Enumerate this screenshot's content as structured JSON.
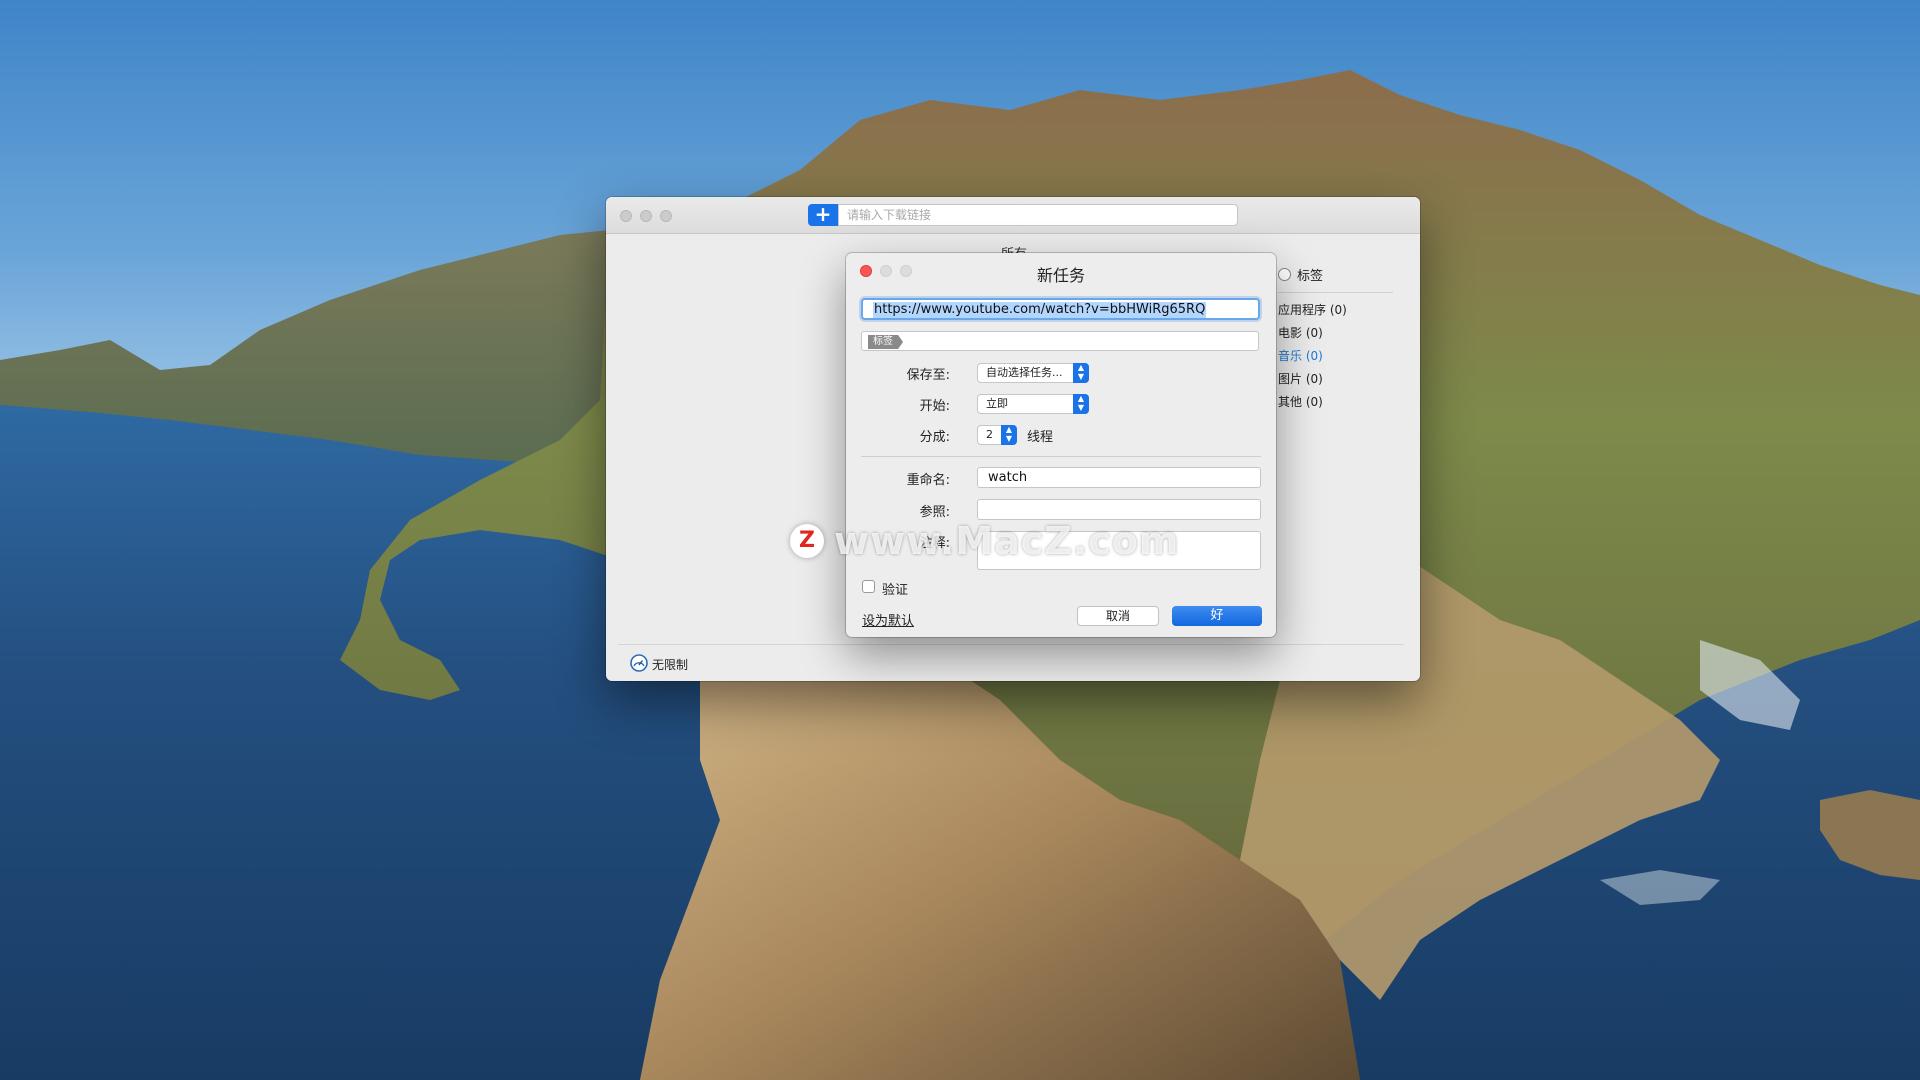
{
  "main_window": {
    "url_placeholder": "请输入下载链接",
    "filter_label": "所有 ⌄",
    "category_header": "标签",
    "categories": [
      {
        "label": "应用程序 (0)",
        "active": false
      },
      {
        "label": "电影 (0)",
        "active": false
      },
      {
        "label": "音乐 (0)",
        "active": true
      },
      {
        "label": "图片 (0)",
        "active": false
      },
      {
        "label": "其他 (0)",
        "active": false
      }
    ],
    "speed_label": "无限制"
  },
  "dialog": {
    "title": "新任务",
    "url_value": "https://www.youtube.com/watch?v=bbHWiRg65RQ",
    "tag_chip": "标签",
    "save_to_label": "保存至:",
    "save_to_value": "自动选择任务...",
    "start_label": "开始:",
    "start_value": "立即",
    "segments_label": "分成:",
    "segments_value": "2",
    "threads_label": "线程",
    "rename_label": "重命名:",
    "rename_value": "watch",
    "referer_label": "参照:",
    "referer_value": "",
    "notes_label": "注释:",
    "notes_value": "",
    "verify_label": "验证",
    "set_default_label": "设为默认",
    "cancel_label": "取消",
    "ok_label": "好"
  },
  "watermark": {
    "logo": "Z",
    "text": "www.MacZ.com"
  },
  "colors": {
    "accent": "#1a73e8",
    "active_category": "#1a7ad4",
    "close_red": "#fc5753"
  }
}
